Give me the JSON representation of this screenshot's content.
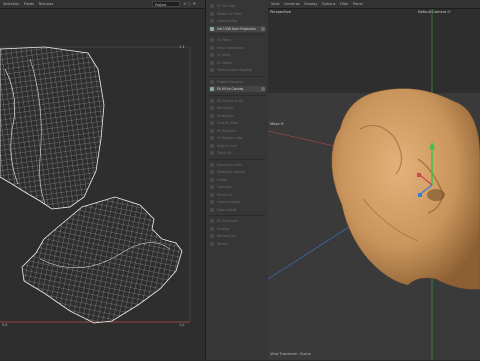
{
  "uv_editor": {
    "menu": [
      "Selection",
      "Fields",
      "Textures"
    ],
    "project_select": "Project",
    "toolbar_glyph": "⊕ ▢ ✥",
    "coords": {
      "top_right": "1,1",
      "bottom_left": "0,0",
      "bottom_right": "1,0"
    }
  },
  "command_panel": {
    "items": [
      {
        "label": "UV Set Size",
        "highlight": false
      },
      {
        "label": "Rotate UV Shell",
        "highlight": false
      },
      {
        "label": "Optimal Map",
        "highlight": false
      },
      {
        "label": "Set UVW from Projection",
        "highlight": true
      },
      {
        "label": "UV Relax",
        "highlight": false
      },
      {
        "label": "Relax Interactive",
        "highlight": false
      },
      {
        "label": "UV Weld",
        "highlight": false
      },
      {
        "label": "UV Match",
        "highlight": false
      },
      {
        "label": "Texture View Mapping",
        "highlight": false
      },
      {
        "label": "Project Mapping",
        "highlight": false
      },
      {
        "label": "Fit UV to Canvas",
        "highlight": true
      },
      {
        "label": "Fit Canvas to UV",
        "highlight": false
      },
      {
        "label": "Normalize",
        "highlight": false
      },
      {
        "label": "Straighten",
        "highlight": false
      },
      {
        "label": "Grid UV Shell",
        "highlight": false
      },
      {
        "label": "Fit Polygons",
        "highlight": false
      },
      {
        "label": "Fit Polygons Big",
        "highlight": false
      },
      {
        "label": "Align to Grid",
        "highlight": false
      },
      {
        "label": "Stitch UV",
        "highlight": false
      },
      {
        "label": "Equalize to Grid",
        "highlight": false
      },
      {
        "label": "Distribute Islands",
        "highlight": false
      },
      {
        "label": "Unfold",
        "highlight": false
      },
      {
        "label": "Optimize",
        "highlight": false
      },
      {
        "label": "Mirror UV",
        "highlight": false
      },
      {
        "label": "Layout Islands",
        "highlight": false
      },
      {
        "label": "Pack Islands",
        "highlight": false
      },
      {
        "label": "UV Transform",
        "highlight": false
      },
      {
        "label": "Unwrap",
        "highlight": false
      },
      {
        "label": "Normal Size",
        "highlight": false
      },
      {
        "label": "Terrain",
        "highlight": false
      }
    ]
  },
  "viewport": {
    "menu": [
      "View",
      "Cameras",
      "Display",
      "Options",
      "Filter",
      "Panel"
    ],
    "view_name": "Perspective",
    "camera_name": "Default Camera ⟳",
    "move_label": "Move ⟳",
    "footer": "View Transform: Scene",
    "colors": {
      "skin": "#c9955c",
      "skin_dark": "#8d5f33",
      "axis_x": "#c94a4a",
      "axis_y": "#35c34a",
      "axis_z": "#3a7bd5"
    }
  }
}
